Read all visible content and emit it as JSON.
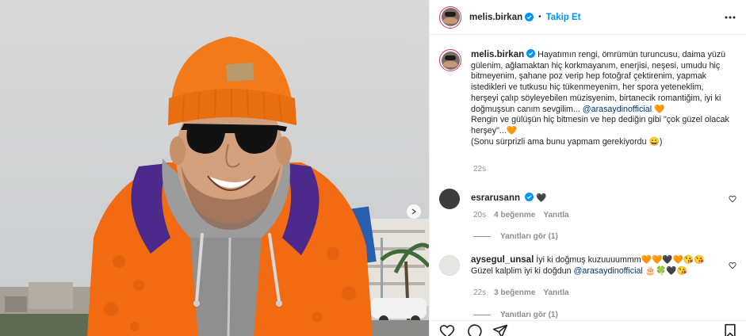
{
  "post": {
    "username": "melis.birkan",
    "separator": "•",
    "follow_label": "Takip Et",
    "caption": {
      "username": "melis.birkan",
      "text_1": "Hayatımın rengi, ömrümün turuncusu, daima yüzü gülenim, ağlamaktan hiç korkmayanım, enerjisi, neşesi, umudu hiç bitmeyenim, şahane poz verip hep fotoğraf çektirenim, yapmak istedikleri ve tutkusu hiç tükenmeyenim, her spora yeteneklim, herşeyi çalıp söyleyebilen müzisyenim, birtanecik romantiğim, iyi ki doğmuşsun canım sevgilim...",
      "mention": "@arasaydinofficial",
      "text_2_emoji": "🧡",
      "text_3": "Rengin ve gülüşün hiç bitmesin ve hep dediğin gibi \"çok güzel olacak herşey\"...🧡",
      "text_4": "(Sonu sürprizli ama bunu yapmam gerekiyordu 😀)",
      "time": "22s"
    }
  },
  "comments": [
    {
      "username": "esrarusann",
      "text": "🖤",
      "time": "20s",
      "likes": "4 beğenme",
      "reply_label": "Yanıtla",
      "view_replies": "Yanıtları gör (1)"
    },
    {
      "username": "aysegul_unsal",
      "text_1": "İyi ki doğmuş kuzuuuummm🧡🧡🖤🧡😘😘Güzel kalplim iyi ki doğdun",
      "mention": "@arasaydinofficial",
      "text_2": "🎂🍀🖤😘",
      "time": "22s",
      "likes": "3 beğenme",
      "reply_label": "Yanıtla",
      "view_replies": "Yanıtları gör (1)"
    }
  ],
  "colors": {
    "accent": "#0095f6",
    "link": "#00376b",
    "muted": "#8e8e8e",
    "text": "#262626",
    "jacket_orange": "#f26a12",
    "beanie_orange": "#f27a1a"
  },
  "icons": [
    "verified-badge-icon",
    "more-options-icon",
    "heart-icon",
    "comment-icon",
    "share-icon",
    "bookmark-icon",
    "carousel-next-icon"
  ]
}
